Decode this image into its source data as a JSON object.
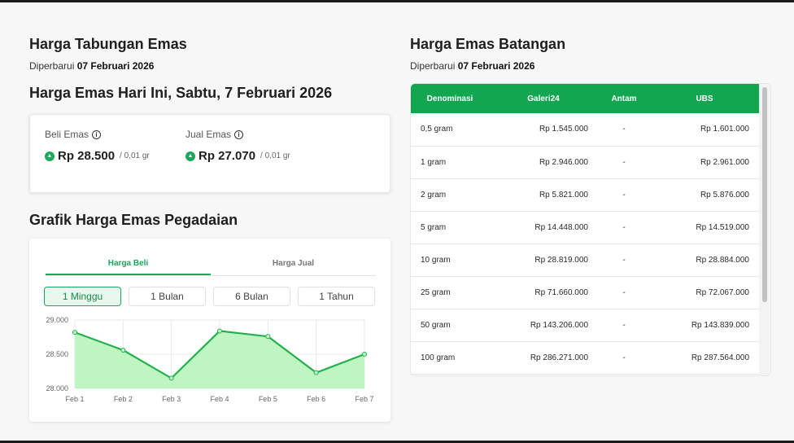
{
  "savings": {
    "title": "Harga Tabungan Emas",
    "updated_prefix": "Diperbarui",
    "updated_date": "07 Februari 2026"
  },
  "today": {
    "title": "Harga Emas Hari Ini, Sabtu, 7 Februari 2026",
    "buy_label": "Beli Emas",
    "buy_value": "Rp 28.500",
    "buy_unit": "/ 0,01 gr",
    "sell_label": "Jual Emas",
    "sell_value": "Rp 27.070",
    "sell_unit": "/ 0,01 gr",
    "info_icon": "info-icon",
    "trend_icon": "arrow-up-icon",
    "accent_color": "#1aa85a"
  },
  "chart_section": {
    "title": "Grafik Harga Emas Pegadaian",
    "tabs": [
      "Harga Beli",
      "Harga Jual"
    ],
    "active_tab": "Harga Beli",
    "ranges": [
      "1 Minggu",
      "1 Bulan",
      "6 Bulan",
      "1 Tahun"
    ],
    "active_range": "1 Minggu"
  },
  "chart_data": {
    "type": "area",
    "categories": [
      "Feb 1",
      "Feb 2",
      "Feb 3",
      "Feb 4",
      "Feb 5",
      "Feb 6",
      "Feb 7"
    ],
    "series": [
      {
        "values": [
          28820,
          28560,
          28150,
          28840,
          28760,
          28230,
          28500
        ]
      }
    ],
    "yticks": [
      "29.000",
      "28.500",
      "28.000"
    ],
    "ylim": [
      28000,
      29000
    ],
    "line_color": "#22b14c",
    "fill_color": "#bff5c2",
    "grid": true
  },
  "bars": {
    "title": "Harga Emas Batangan",
    "updated_prefix": "Diperbarui",
    "updated_date": "07 Februari 2026",
    "header_color": "#12a650",
    "columns": [
      "Denominasi",
      "Galeri24",
      "Antam",
      "UBS"
    ],
    "rows": [
      [
        "0,5 gram",
        "Rp 1.545.000",
        "-",
        "Rp 1.601.000"
      ],
      [
        "1 gram",
        "Rp 2.946.000",
        "-",
        "Rp 2.961.000"
      ],
      [
        "2 gram",
        "Rp 5.821.000",
        "-",
        "Rp 5.876.000"
      ],
      [
        "5 gram",
        "Rp 14.448.000",
        "-",
        "Rp 14.519.000"
      ],
      [
        "10 gram",
        "Rp 28.819.000",
        "-",
        "Rp 28.884.000"
      ],
      [
        "25 gram",
        "Rp 71.660.000",
        "-",
        "Rp 72.067.000"
      ],
      [
        "50 gram",
        "Rp 143.206.000",
        "-",
        "Rp 143.839.000"
      ],
      [
        "100 gram",
        "Rp 286.271.000",
        "-",
        "Rp 287.564.000"
      ]
    ]
  }
}
